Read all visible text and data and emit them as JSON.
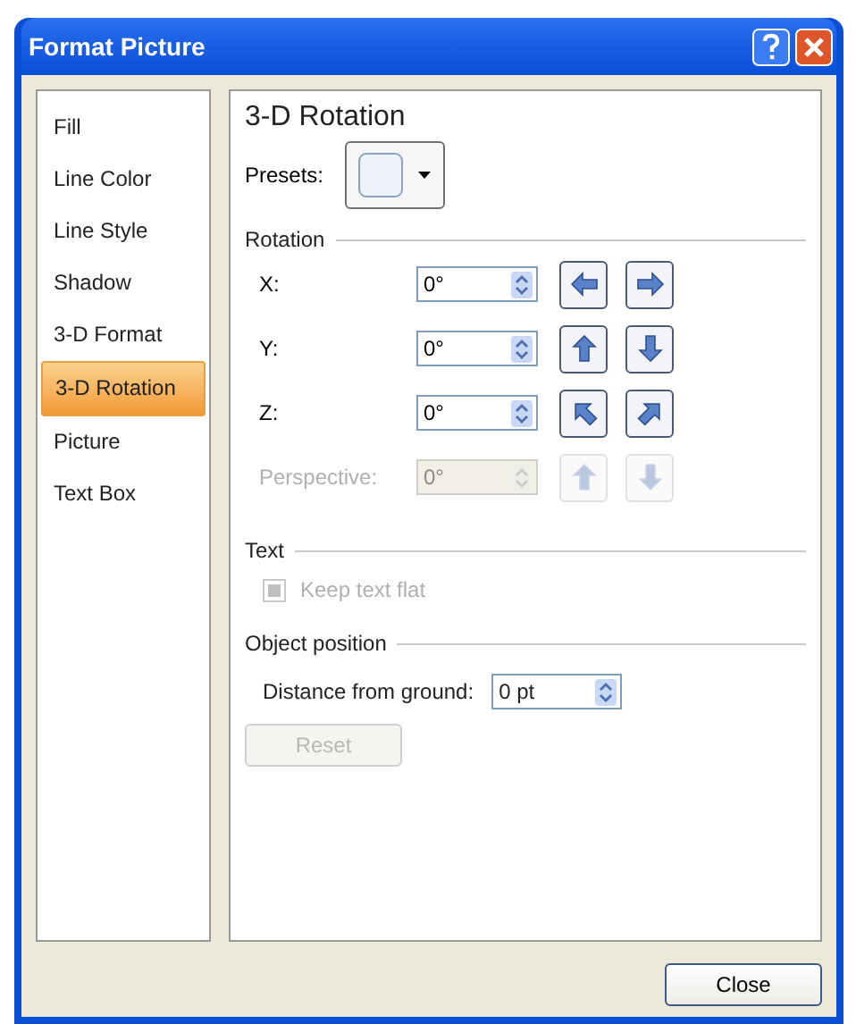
{
  "window": {
    "title": "Format Picture"
  },
  "sidebar": {
    "items": [
      {
        "label": "Fill",
        "selected": false
      },
      {
        "label": "Line Color",
        "selected": false
      },
      {
        "label": "Line Style",
        "selected": false
      },
      {
        "label": "Shadow",
        "selected": false
      },
      {
        "label": "3-D Format",
        "selected": false
      },
      {
        "label": "3-D Rotation",
        "selected": true
      },
      {
        "label": "Picture",
        "selected": false
      },
      {
        "label": "Text Box",
        "selected": false
      }
    ]
  },
  "panel": {
    "heading": "3-D Rotation",
    "presets_label": "Presets:",
    "rotation": {
      "title": "Rotation",
      "rows": [
        {
          "label": "X:",
          "value": "0°",
          "disabled": false
        },
        {
          "label": "Y:",
          "value": "0°",
          "disabled": false
        },
        {
          "label": "Z:",
          "value": "0°",
          "disabled": false
        },
        {
          "label": "Perspective:",
          "value": "0°",
          "disabled": true
        }
      ]
    },
    "text": {
      "title": "Text",
      "checkbox": {
        "label": "Keep text flat",
        "checked": true,
        "disabled": true
      }
    },
    "object_position": {
      "title": "Object position",
      "field": {
        "label": "Distance from ground:",
        "value": "0 pt"
      }
    },
    "reset": {
      "label": "Reset",
      "disabled": true
    }
  },
  "buttons": [
    "Close"
  ]
}
